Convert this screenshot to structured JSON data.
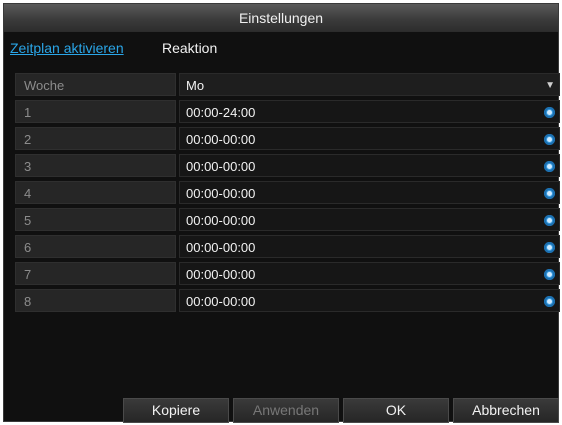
{
  "window": {
    "title": "Einstellungen"
  },
  "tabs": [
    {
      "label": "Zeitplan aktivieren",
      "active": true
    },
    {
      "label": "Reaktion",
      "active": false
    }
  ],
  "schedule": {
    "week_label": "Woche",
    "week_value": "Mo",
    "rows": [
      {
        "index": "1",
        "time": "00:00-24:00"
      },
      {
        "index": "2",
        "time": "00:00-00:00"
      },
      {
        "index": "3",
        "time": "00:00-00:00"
      },
      {
        "index": "4",
        "time": "00:00-00:00"
      },
      {
        "index": "5",
        "time": "00:00-00:00"
      },
      {
        "index": "6",
        "time": "00:00-00:00"
      },
      {
        "index": "7",
        "time": "00:00-00:00"
      },
      {
        "index": "8",
        "time": "00:00-00:00"
      }
    ]
  },
  "buttons": {
    "copy": "Kopiere",
    "apply": "Anwenden",
    "ok": "OK",
    "cancel": "Abbrechen"
  },
  "icons": {
    "row_settings": "gear-icon",
    "dropdown": "chevron-down-icon"
  },
  "colors": {
    "accent": "#2aa6e8",
    "background": "#101010",
    "gear": "#3a9de0"
  }
}
